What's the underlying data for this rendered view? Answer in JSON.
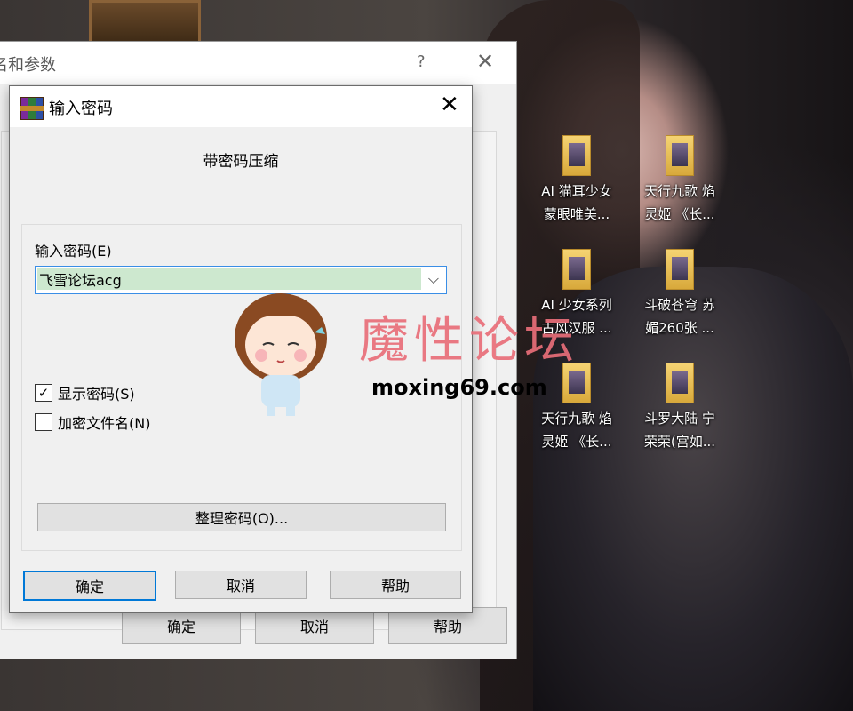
{
  "desktop": {
    "icons": [
      {
        "line1": "AI  猫耳少女",
        "line2": "蒙眼唯美..."
      },
      {
        "line1": "天行九歌 焰",
        "line2": "灵姬 《长..."
      },
      {
        "line1": "AI 少女系列",
        "line2": "古风汉服 ..."
      },
      {
        "line1": "斗破苍穹 苏",
        "line2": "媚260张 ..."
      },
      {
        "line1": "天行九歌 焰",
        "line2": "灵姬 《长..."
      },
      {
        "line1": "斗罗大陆 宁",
        "line2": "荣荣(宫如..."
      }
    ]
  },
  "bg_dialog": {
    "title": "名和参数",
    "help_glyph": "?",
    "close_glyph": "✕",
    "buttons": {
      "ok": "确定",
      "cancel": "取消",
      "help": "帮助"
    }
  },
  "pw_dialog": {
    "title": "输入密码",
    "close_glyph": "✕",
    "heading": "带密码压缩",
    "field_label": "输入密码(E)",
    "password_value": "飞雪论坛acg",
    "show_password": {
      "label": "显示密码(S)",
      "checked": true,
      "check_glyph": "✓"
    },
    "encrypt_filenames": {
      "label": "加密文件名(N)",
      "checked": false
    },
    "manage_button": "整理密码(O)...",
    "buttons": {
      "ok": "确定",
      "cancel": "取消",
      "help": "帮助"
    }
  },
  "watermark": {
    "title": "魔性论坛",
    "url": "moxing69.com"
  }
}
